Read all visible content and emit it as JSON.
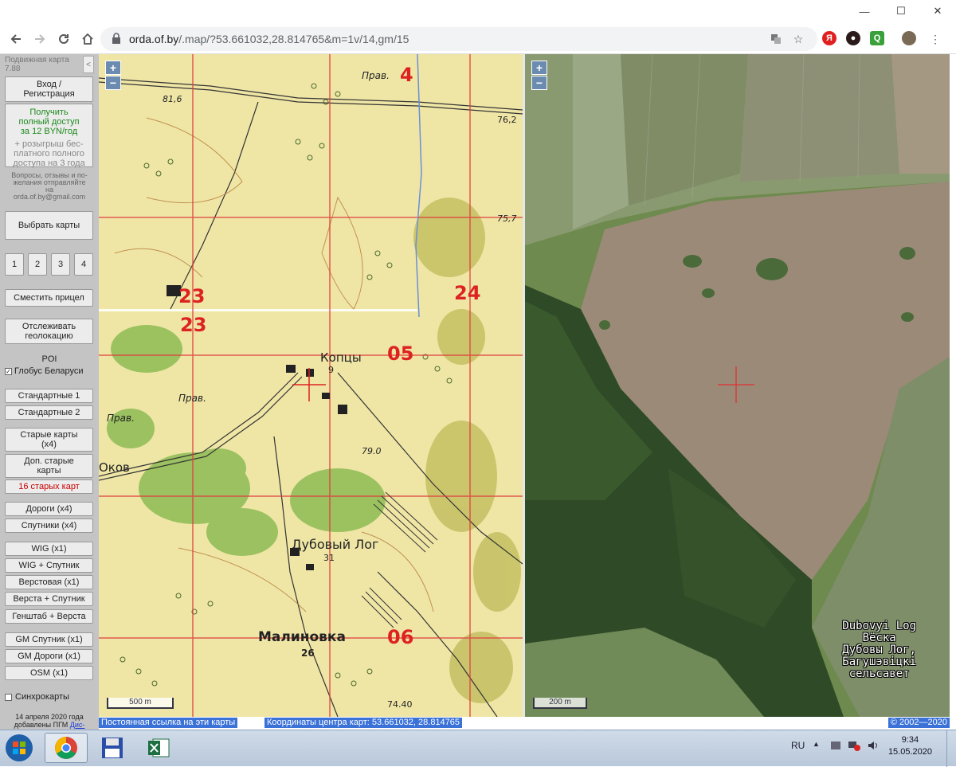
{
  "browser": {
    "url_host": "orda.of.by",
    "url_path": "/.map/?53.661032,28.814765&m=1v/14,gm/15",
    "win_min": "—",
    "win_max": "☐",
    "win_close": "✕"
  },
  "sidebar": {
    "title": "Подвижная карта",
    "version": "7.88",
    "collapse": "<",
    "login": "Вход / Регистрация",
    "access_lines": [
      "Получить",
      "полный доступ",
      "за 12 BYN/год"
    ],
    "raffle_lines": [
      "+ розыгрыш бес-",
      "платного полного",
      "доступа на 3 года"
    ],
    "contact_lines": [
      "Вопросы, отзывы и по-",
      "желания отправляйте",
      "на",
      "orda.of.by@gmail.com"
    ],
    "choose_maps": "Выбрать карты",
    "num_buttons": [
      "1",
      "2",
      "3",
      "4"
    ],
    "shift_crosshair": "Сместить прицел",
    "track_geo": "Отслеживать геолокацию",
    "poi": "POI",
    "globus": "Глобус Беларуси",
    "standard1": "Стандартные 1",
    "standard2": "Стандартные 2",
    "old_maps": "Старые карты (x4)",
    "extra_old_maps": "Доп. старые карты",
    "sixteen_old": "16 старых карт",
    "roads": "Дороги (x4)",
    "satellites": "Спутники (x4)",
    "wig": "WIG (x1)",
    "wig_sat": "WIG + Спутник",
    "versta": "Верстовая (x1)",
    "versta_sat": "Верста + Спутник",
    "genshtab": "Генштаб + Верста",
    "gm_sat": "GM Спутник (x1)",
    "gm_roads": "GM Дороги (x1)",
    "osm": "OSM (x1)",
    "sync": "Синхрокарты",
    "footnote": "14 апреля 2020 года добавлены ПГМ ",
    "footnote_link": "Дис-"
  },
  "map_left": {
    "zoom_in": "+",
    "zoom_out": "−",
    "scale": "500 m",
    "labels": {
      "prav_top": "Прав.",
      "height_816": "81,6",
      "height_762": "76,2",
      "height_757": "75,7",
      "village_koptsy": "Копцы",
      "koptsy_num": "9",
      "prav_mid": "Прав.",
      "prav_left": "Прав.",
      "okov": "Оков",
      "height_790": "79.0",
      "village_dubovy": "Дубовый Лог",
      "dubovy_num": "31",
      "village_malinovka": "Малиновка",
      "malinovka_num": "26",
      "height_744": "74.40"
    },
    "grid_numbers": [
      "4",
      "23",
      "24",
      "23",
      "05",
      "06"
    ]
  },
  "map_right": {
    "zoom_in": "+",
    "zoom_out": "−",
    "scale": "200 m",
    "place_lines": [
      "Dubovyi Log",
      "Вёска",
      "Дубовы Лог,",
      "Багушэвіцкі",
      "сельсавет"
    ]
  },
  "infobar": {
    "permalink": "Постоянная ссылка на эти карты",
    "coords": "Координаты центра карт: 53.661032, 28.814765",
    "copyright": "© 2002—2020"
  },
  "taskbar": {
    "lang": "RU",
    "time": "9:34",
    "date": "15.05.2020"
  },
  "colors": {
    "map_paper": "#efe6a6",
    "forest_green": "#8dbb54",
    "grid_red": "#e04040",
    "link_blue": "#3a72d8"
  }
}
